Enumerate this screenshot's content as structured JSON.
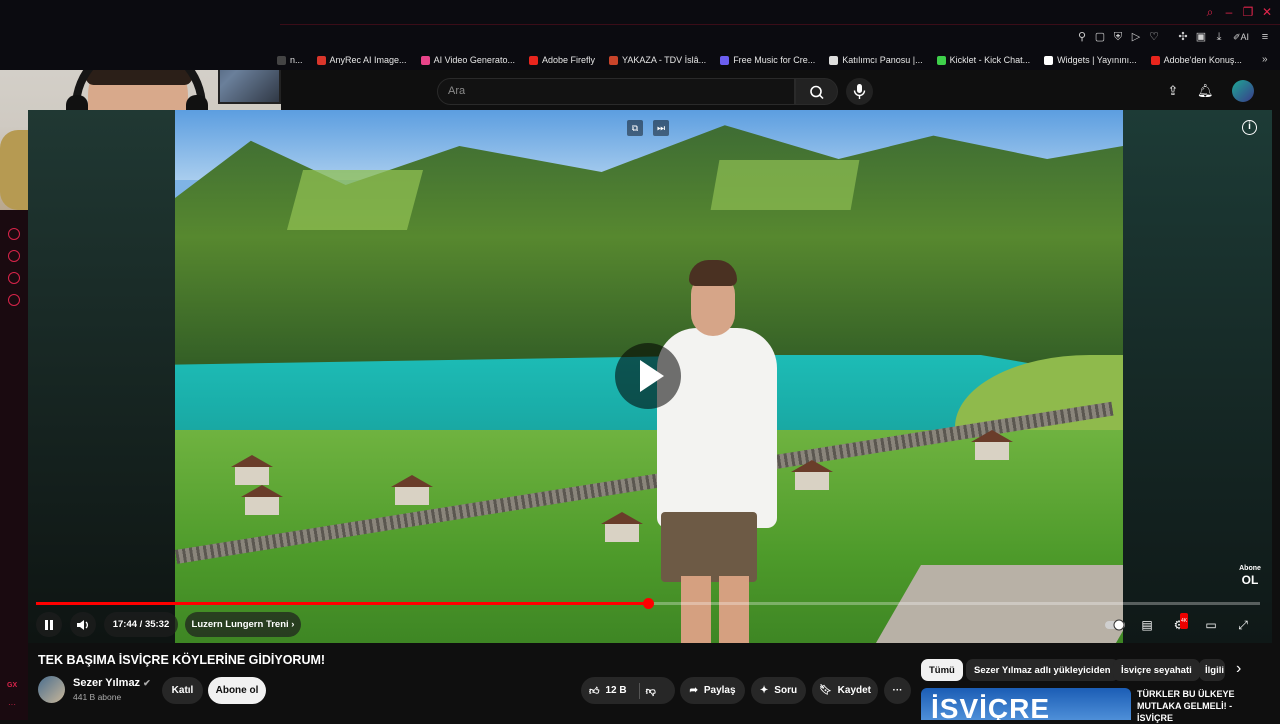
{
  "browser": {
    "bookmarks": [
      {
        "label": "n...",
        "color": "#444444"
      },
      {
        "label": "AnyRec AI Image...",
        "color": "#d9362b"
      },
      {
        "label": "AI Video Generato...",
        "color": "#e8448a"
      },
      {
        "label": "Adobe Firefly",
        "color": "#e8251d"
      },
      {
        "label": "YAKAZA - TDV İslâ...",
        "color": "#c8442a"
      },
      {
        "label": "Free Music for Cre...",
        "color": "#6b5ef0"
      },
      {
        "label": "Katılımcı Panosu |...",
        "color": "#dddddd"
      },
      {
        "label": "Kicklet - Kick Chat...",
        "color": "#3ecf4a"
      },
      {
        "label": "Widgets | Yayınını...",
        "color": "#ffffff"
      },
      {
        "label": "Adobe'den Konuş...",
        "color": "#e8251d"
      }
    ],
    "toolbar_ai_label": "AI",
    "accent": "#e0254b"
  },
  "header": {
    "search_placeholder": "Ara"
  },
  "player": {
    "time_current": "17:44",
    "time_separator": "/",
    "time_total": "35:32",
    "chapter": "Luzern Lungern Treni",
    "progress": 0.5,
    "abone_top": "Abone",
    "abone_bottom": "OL",
    "settings_badge": "4K"
  },
  "video": {
    "title": "TEK BAŞIMA İSVİÇRE KÖYLERİNE GİDİYORUM!",
    "channel": "Sezer Yılmaz",
    "subscribers": "441 B abone",
    "join_label": "Katıl",
    "subscribe_label": "Abone ol",
    "likes": "12 B",
    "share_label": "Paylaş",
    "ask_label": "Soru",
    "save_label": "Kaydet",
    "more_label": "···"
  },
  "chips": [
    {
      "label": "Tümü"
    },
    {
      "label": "Sezer Yılmaz adlı yükleyiciden"
    },
    {
      "label": "İsviçre seyahati"
    },
    {
      "label": "İlgili"
    }
  ],
  "recommendation": {
    "thumb_text": "İSVİÇRE",
    "title": "TÜRKLER BU ÜLKEYE MUTLAKA GELMELİ! - İSVİÇRE"
  }
}
